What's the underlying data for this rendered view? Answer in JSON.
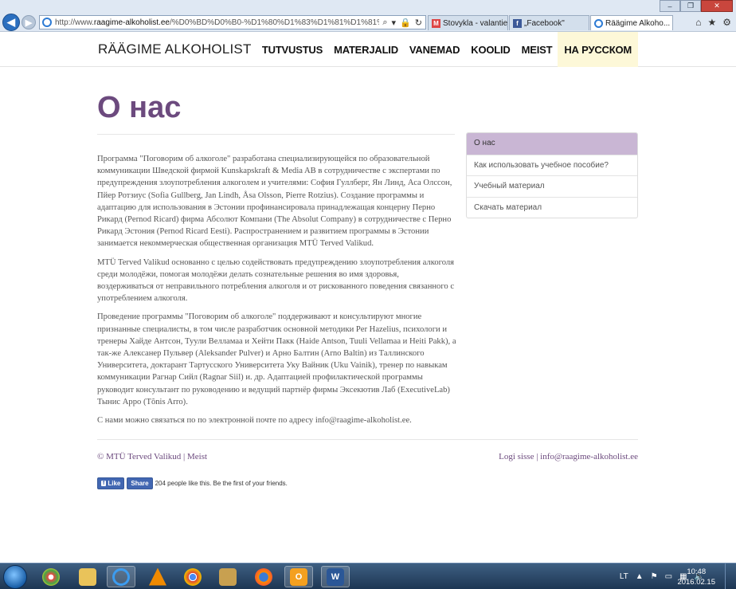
{
  "browser": {
    "url_prefix": "http://www.",
    "url_domain": "raagime-alkoholist.ee",
    "url_rest": "/%D0%BD%D0%B0-%D1%80%D1%83%D1%81%D1%81%D0%BA%D0%BE%D0",
    "tabs": [
      {
        "label": "Stovykla - valantieji...",
        "icon": "gmail-icon",
        "active": false
      },
      {
        "label": "„Facebook\"",
        "icon": "facebook-icon",
        "active": false
      },
      {
        "label": "Räägime Alkoho...",
        "icon": "ie-icon",
        "active": true
      }
    ],
    "window_controls": [
      "–",
      "❐",
      "✕"
    ]
  },
  "site": {
    "brand": "RÄÄGIME ALKOHOLIST",
    "menu": [
      "TUTVUSTUS",
      "MATERJALID",
      "VANEMAD",
      "KOOLID",
      "MEIST",
      "НА РУССКОМ"
    ],
    "page_title": "О нас",
    "paragraphs": [
      "Программа \"Поговорим об алкоголе\" разработана специализирующейся по образовательной коммуникации Шведской фирмой Kunskapskraft & Media AB в сотрудничестве с экспертами по предупреждения злоупотребления алкоголем и учителями: София Гуллберг, Ян Линд, Аса Олссон, Пйер Ротзиус (Sofia Gullberg, Jan Lindh, Åsa Olsson, Pierre Rotzius). Создание программы и адаптацию для использования в Эстонии профинансировала принадлежащая концерну Перно Рикард (Pernod Ricard) фирма Абсолют Компани (The Absolut Company) в сотрудничестве с Перно Рикард Эстония (Pernod Ricard Eesti). Распространением и развитием программы в Эстонии занимается некоммерческая общественная организация MTÜ Terved Valikud.",
      "MTÜ Terved Valikud основанно с целью содействовать предупреждению злоупотребления алкоголя среди молодёжи, помогая молодёжи делать сознательные решения во имя здоровья, воздерживаться от неправильного потребления алкоголя и от рискованного поведения связанного с употреблением алкоголя.",
      "Проведение программы \"Поговорим об алкоголе\" поддерживают и консультируют многие признанные специалисты, в том числе разработчик основной методики Per Hazelius, психологи и тренеры Хайде Антсон, Туули Велламаа и Хейти Пакк (Haide Antson, Tuuli Vellamaa и Heiti Pakk), а так-же Алексанер Пульвер (Aleksander Pulver) и Арно Балтин (Arno Baltin) из Таллинского Университета, доктарант Тартусского Университета Уку Вайник (Uku Vainik), тренер по навыкам коммуникации Рагнар Сийл (Ragnar Siil) и. др. Адаптацией профилактической программы руководит консультант по руководению и ведущий партнёр фирмы Эксекютив Лаб (ExecutiveLab) Тынис Арро (Tõnis Arro).",
      "С нами можно связаться по по электронной почте по адресу info@raagime-alkoholist.ee."
    ],
    "sidebar": [
      "О нас",
      "Как использовать учебное пособие?",
      "Учебный материал",
      "Скачать материал"
    ],
    "footer": {
      "copyright": "© MTÜ Terved Valikud",
      "sep": "|",
      "meist": "Meist",
      "login": "Logi sisse",
      "email": "info@raagime-alkoholist.ee"
    },
    "facebook": {
      "like": "Like",
      "share": "Share",
      "text": "204 people like this. Be the first of your friends."
    }
  },
  "taskbar": {
    "lang": "LT",
    "time": "10:48",
    "date": "2016.02.15"
  },
  "colors": {
    "accent": "#6c4a7e",
    "sidebar_active": "#c9b6d4",
    "menu_highlight": "#fdf8d8"
  }
}
